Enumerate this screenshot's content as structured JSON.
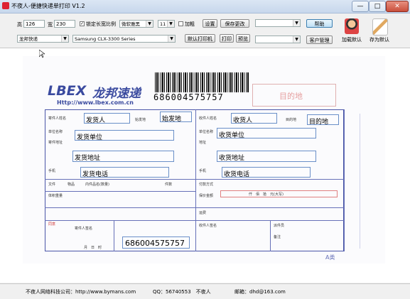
{
  "window": {
    "title": "不夜人-便捷快递单打印 V1.2",
    "controls": [
      "—",
      "□",
      "✕"
    ]
  },
  "toolbar": {
    "height_label": "高",
    "height_value": "126",
    "width_label": "宽",
    "width_value": "230",
    "lock_ratio_label": "锁定长宽比例",
    "lock_ratio_checked": true,
    "font_value": "微软雅黑",
    "font_size_value": "11",
    "bold_label": "加粗",
    "settings_label": "设置",
    "save_changes_label": "保存更改",
    "template_value": "",
    "help_label": "帮助",
    "carrier_value": "龙邦快递",
    "printer_value": "Samsung CLX-3300 Series",
    "default_printer_label": "默认打印机",
    "print_label": "打印",
    "preview_label": "预览",
    "customer_value": "",
    "customer_mgmt_label": "客户管理",
    "load_default_label": "加载默认",
    "save_default_label": "存为默认"
  },
  "waybill": {
    "logo_en": "LBEX",
    "logo_cn": "龙邦速递",
    "website": "Http://www.lbex.com.cn",
    "tracking_number": "686004575757",
    "dest_label": "目的地",
    "sender_name": "发货人",
    "origin": "始发地",
    "sender_company": "发货单位",
    "sender_address": "发货地址",
    "sender_phone": "发货电话",
    "receiver_name": "收货人",
    "destination": "目的地",
    "receiver_company": "收货单位",
    "receiver_address": "收货地址",
    "receiver_phone": "收货电话",
    "tracking_number_lower": "686004575757",
    "labels": {
      "sender_name": "寄件人姓名",
      "origin_code": "始发地",
      "company": "单位名称",
      "address": "寄件地址",
      "phone": "手机",
      "receiver_name": "收件人姓名",
      "dest_code": "目的地",
      "recv_company": "单位名称",
      "recv_address": "地址",
      "recv_phone": "手机",
      "file": "文件",
      "goods": "物品",
      "goods_name": "内件品名(数量)",
      "count": "件数",
      "weight_row": "体积重量",
      "pay_method": "付款方式",
      "insured": "保价金额",
      "amount_row": "仟　佰　拾　元(大写)",
      "fee": "运费",
      "recv_sign": "收件人签名",
      "date_row": "月　日　时",
      "courier_sign": "派件员",
      "remark": "备注",
      "a_class": "A类",
      "agree": "同意",
      "sender_sign_note": "寄件人签名"
    }
  },
  "status": {
    "company": "不夜人网络科技公司：http://www.bymans.com",
    "qq": "QQ：56740553　不夜人",
    "email": "邮箱：dhd@163.com"
  }
}
